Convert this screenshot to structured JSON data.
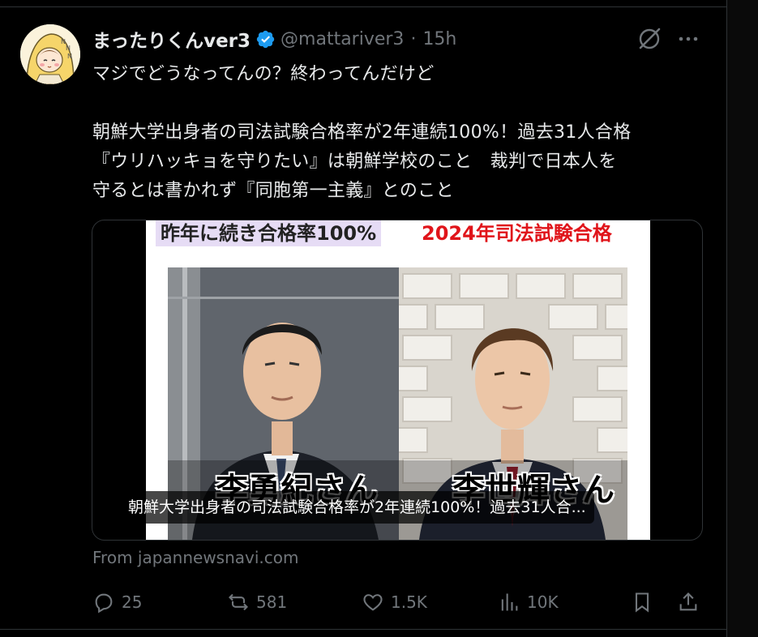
{
  "tweet": {
    "author": {
      "display_name": "まったりくんver3",
      "handle": "@mattariver3",
      "verified": true,
      "separator": "·",
      "time_ago": "15h"
    },
    "text_lines": [
      "マジでどうなってんの？終わってんだけど",
      "朝鮮大学出身者の司法試験合格率が2年連続100%！過去31人合格",
      "『ウリハッキョを守りたい』は朝鮮学校のこと　裁判で日本人を",
      "守るとは書かれず『同胞第一主義』とのこと"
    ],
    "card": {
      "banner_left": "昨年に続き合格率100%",
      "banner_right": "2024年司法試験合格",
      "name_left": "李勇紀さん",
      "name_right": "李世輝さん",
      "caption": "朝鮮大学出身者の司法試験合格率が2年連続100%！過去31人合..."
    },
    "source": "From japannewsnavi.com",
    "actions": {
      "replies": "25",
      "reposts": "581",
      "likes": "1.5K",
      "views": "10K"
    }
  },
  "colors": {
    "background": "#000000",
    "text_primary": "#e7e9ea",
    "text_secondary": "#71767b",
    "verified_blue": "#1d9bf0",
    "border": "#2f3336",
    "banner_red": "#e0141a"
  },
  "icons": [
    "verified-badge-icon",
    "grok-icon",
    "more-icon",
    "reply-icon",
    "repost-icon",
    "like-icon",
    "views-icon",
    "bookmark-icon",
    "share-icon"
  ]
}
